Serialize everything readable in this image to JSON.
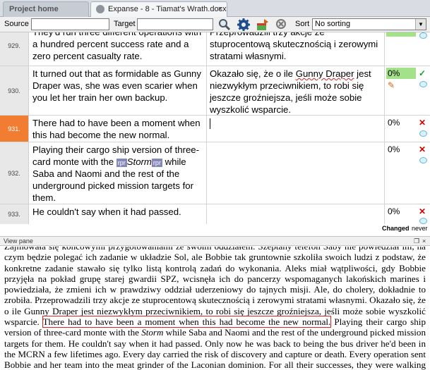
{
  "tabs": [
    {
      "label": "Project home"
    },
    {
      "label": "Expanse - 8 - Tiamat's Wrath.docx",
      "close": "×"
    }
  ],
  "toolbar": {
    "source_label": "Source",
    "target_label": "Target",
    "sort_label": "Sort",
    "sort_value": "No sorting",
    "icons": [
      "search-icon",
      "gear-icon",
      "import-icon",
      "clear-icon"
    ]
  },
  "rows": [
    {
      "num": "929.",
      "source": "They'd run three different operations with a hundred percent success rate and a zero percent casualty rate.",
      "target": "Przeprowadzili trzy akcje ze stuprocentową skutecznością i zerowymi stratami własnymi.",
      "pct": ""
    },
    {
      "num": "930.",
      "source": "It turned out that as formidable as Gunny Draper was, she was even scarier when you let her train her own backup.",
      "target_pre": "Okazało się, że o ile ",
      "target_name": "Gunny Draper",
      "target_post": " jest niezwykłym przeciwnikiem, to robi się jeszcze groźniejsza, jeśli może sobie wyszkolić wsparcie.",
      "pct": "0%"
    },
    {
      "num": "931.",
      "source": "There had to have been a moment when this had become the new normal.",
      "target": "",
      "pct": "0%"
    },
    {
      "num": "932.",
      "source_a": "Playing their cargo ship version of three-card monte with the ",
      "tag_open": "rpr",
      "storm": "Storm",
      "tag_close": "rpr",
      "source_b": " while Saba and Naomi and the rest of the underground picked mission targets for them.",
      "target": "",
      "pct": "0%"
    },
    {
      "num": "933.",
      "source": "He couldn't say when it had passed.",
      "target": "",
      "pct": "0%"
    }
  ],
  "legend": {
    "changed": "Changed",
    "never": "never"
  },
  "view_pane": {
    "title": "View pane",
    "para_pre": "Zajmowała się końcowymi przygotowaniami ze swoim oddziałem. Szeptany telefon Saby nie powiedział im, na czym będzie polegać ich zadanie w układzie Sol, ale Bobbie tak gruntownie szkoliła swoich ludzi z podstaw, że konkretne zadanie stawało się tylko listą kontrolą zadań do wykonania. Aleks miał wątpliwości, gdy Bobbie przyjęła na pokład grupę starej gwardii SPZ, wcisnęła ich do pancerzy wspomaganych lakońskich marines i powiedziała, że zmieni ich w prawdziwy oddział uderzeniowy do tajnych misji. Ale, do cholery, dokładnie to zrobiła. Przeprowadzili trzy akcje ze stuprocentową skutecznością i zerowymi stratami własnymi. Okazało się, że o ile Gunny Draper jest niezwykłym przeciwnikiem, to robi się jeszcze groźniejsza, jeśli może sobie wyszkolić wsparcie. ",
    "para_hl": "There had to have been a moment when this had become the new normal.",
    "para_mid": " Playing their cargo ship version of three-card monte with the ",
    "para_storm": "Storm",
    "para_post": " while Saba and Naomi and the rest of the underground picked mission targets for them. He couldn't say when it had passed. Only now he was back to being the bus driver he'd been in the MCRN a few lifetimes ago. Every day carried the risk of discovery and capture or death. Every operation sent Bobbie and her team into the meat grinder of the Laconian dominion. For all their successes, they were walking on the edge of a razor blade. If he'd been twenty and unaware of his own mortality, he'd probably have loved it."
  }
}
